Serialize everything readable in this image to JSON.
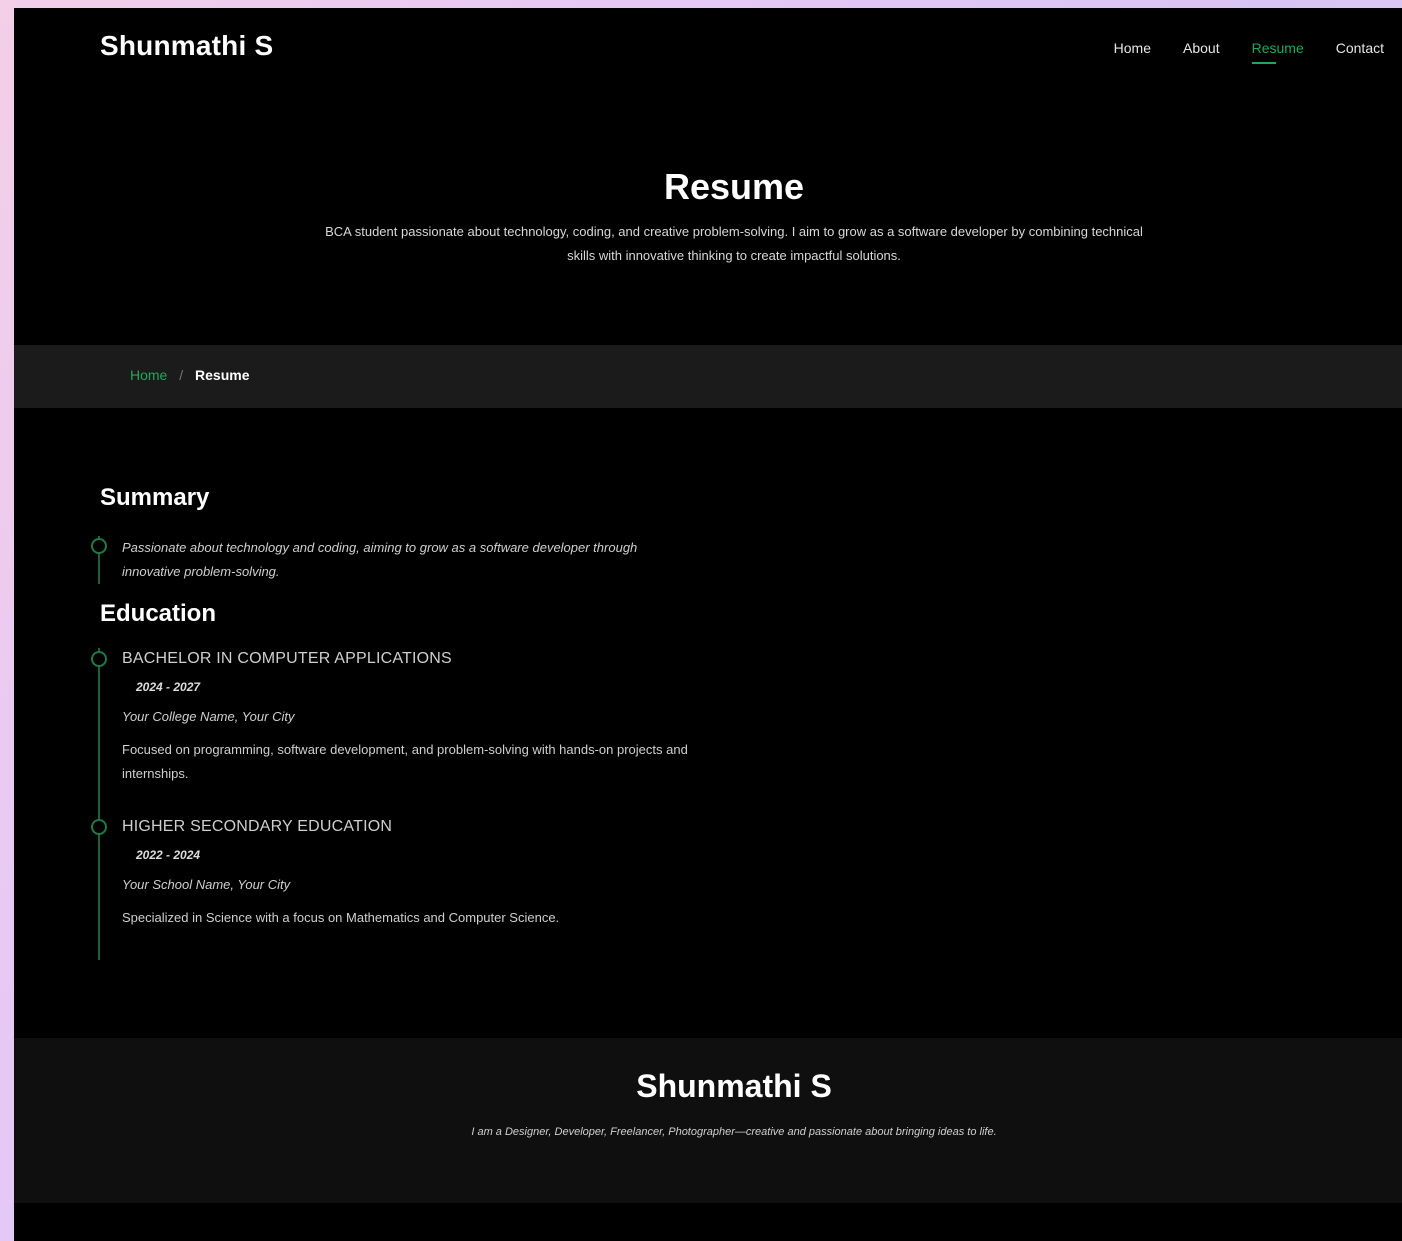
{
  "header": {
    "logo": "Shunmathi S",
    "nav": [
      {
        "label": "Home"
      },
      {
        "label": "About"
      },
      {
        "label": "Resume"
      },
      {
        "label": "Contact"
      }
    ],
    "active_nav": "Resume"
  },
  "hero": {
    "title": "Resume",
    "text": "BCA student passionate about technology, coding, and creative problem-solving. I aim to grow as a software developer by combining technical skills with innovative thinking to create impactful solutions."
  },
  "breadcrumb": {
    "home": "Home",
    "separator": "/",
    "current": "Resume"
  },
  "summary": {
    "title": "Summary",
    "text": "Passionate about technology and coding, aiming to grow as a software developer through innovative problem-solving."
  },
  "education": {
    "title": "Education",
    "items": [
      {
        "degree": "Bachelor in Computer Applications",
        "years": "2024 - 2027",
        "place": "Your College Name, Your City",
        "description": "Focused on programming, software development, and problem-solving with hands-on projects and internships."
      },
      {
        "degree": "Higher Secondary Education",
        "years": "2022 - 2024",
        "place": "Your School Name, Your City",
        "description": "Specialized in Science with a focus on Mathematics and Computer Science."
      }
    ]
  },
  "footer": {
    "name": "Shunmathi S",
    "tagline": "I am a Designer, Developer, Freelancer, Photographer—creative and passionate about bringing ideas to life."
  },
  "colors": {
    "accent": "#1fa85a",
    "background": "#000000",
    "breadcrumb_bg": "#1b1b1b",
    "footer_bg": "#0f0f0f"
  }
}
